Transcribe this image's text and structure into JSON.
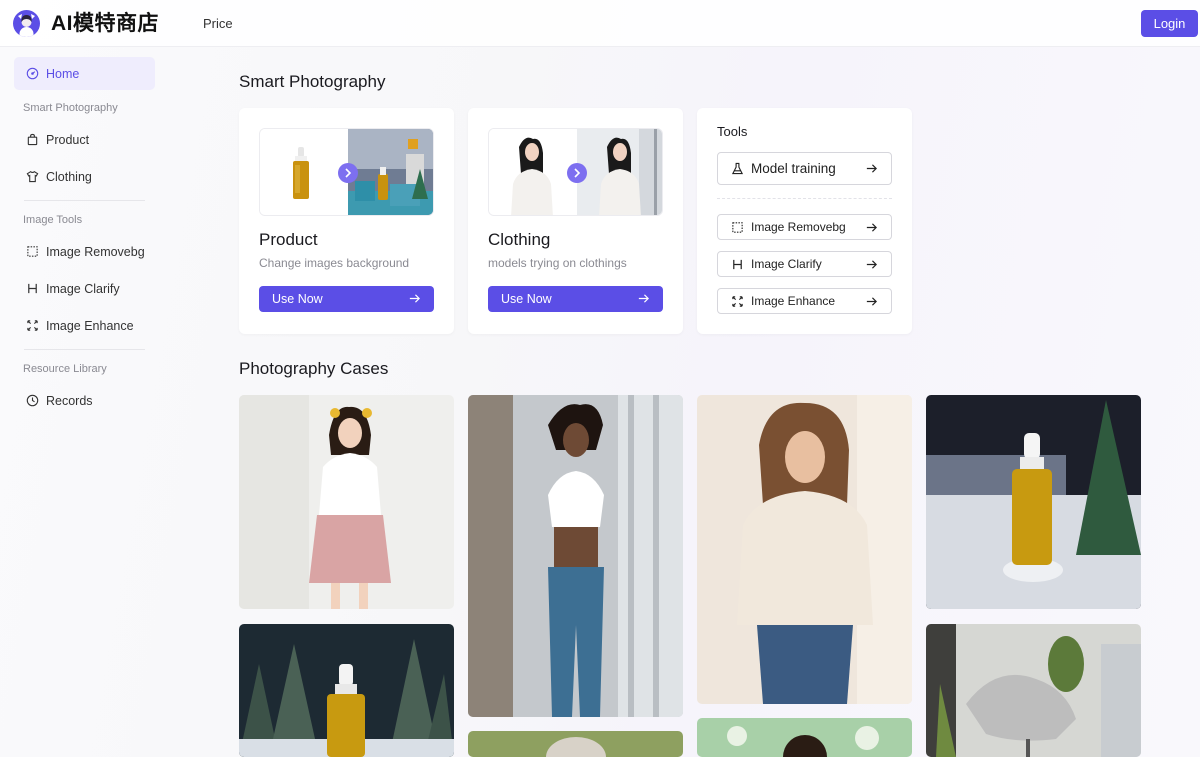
{
  "header": {
    "logo_text": "AI模特商店",
    "nav_price": "Price",
    "login_label": "Login"
  },
  "sidebar": {
    "home": "Home",
    "group_smart": "Smart Photography",
    "product": "Product",
    "clothing": "Clothing",
    "group_tools": "Image Tools",
    "removebg": "Image Removebg",
    "clarify": "Image Clarify",
    "enhance": "Image Enhance",
    "group_resource": "Resource Library",
    "records": "Records"
  },
  "main": {
    "smart_title": "Smart Photography",
    "product_card": {
      "title": "Product",
      "desc": "Change images background",
      "button": "Use Now"
    },
    "clothing_card": {
      "title": "Clothing",
      "desc": "models trying on clothings",
      "button": "Use Now"
    },
    "tools_card": {
      "title": "Tools",
      "model_training": "Model training",
      "removebg": "Image Removebg",
      "clarify": "Image Clarify",
      "enhance": "Image Enhance"
    },
    "cases_title": "Photography Cases"
  },
  "colors": {
    "accent": "#5b4ee6",
    "active_bg": "#efedfd"
  },
  "icons": [
    "logo-icon",
    "dashboard-icon",
    "bag-icon",
    "shirt-icon",
    "crop-icon",
    "h-icon",
    "expand-icon",
    "clock-icon",
    "flask-icon",
    "arrow-right-icon",
    "chevron-right-icon"
  ]
}
